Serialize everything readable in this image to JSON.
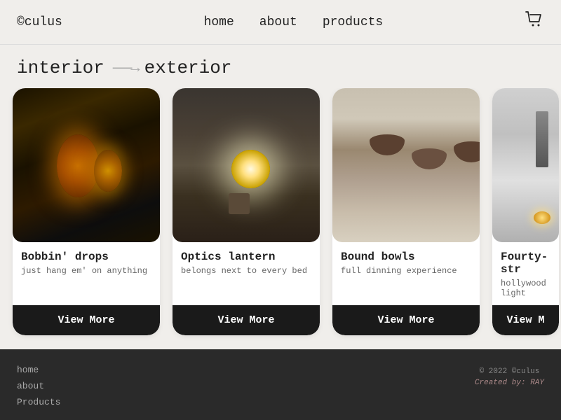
{
  "header": {
    "logo": "©culus",
    "nav": {
      "home": "home",
      "about": "about",
      "products": "products"
    },
    "cart_icon": "🛒"
  },
  "hero": {
    "left": "interior",
    "arrow": "–––→",
    "right": "exterior"
  },
  "products": [
    {
      "id": "bobbin",
      "title": "Bobbin' drops",
      "description": "just hang em' on anything",
      "btn_label": "View More",
      "img_class": "img-bobbin"
    },
    {
      "id": "optics",
      "title": "Optics lantern",
      "description": "belongs next to every bed",
      "btn_label": "View More",
      "img_class": "img-optics"
    },
    {
      "id": "bowls",
      "title": "Bound bowls",
      "description": "full dinning experience",
      "btn_label": "View More",
      "img_class": "img-bowls"
    },
    {
      "id": "fourty",
      "title": "Fourty-str",
      "description": "hollywood light",
      "btn_label": "View M",
      "img_class": "img-fourty",
      "partial": true
    }
  ],
  "footer": {
    "links": [
      {
        "label": "home",
        "href": "#"
      },
      {
        "label": "about",
        "href": "#"
      },
      {
        "label": "Products",
        "href": "#"
      }
    ],
    "copyright": "© 2022 ©culus",
    "created_label": "Created by:",
    "created_by": "RAY"
  }
}
